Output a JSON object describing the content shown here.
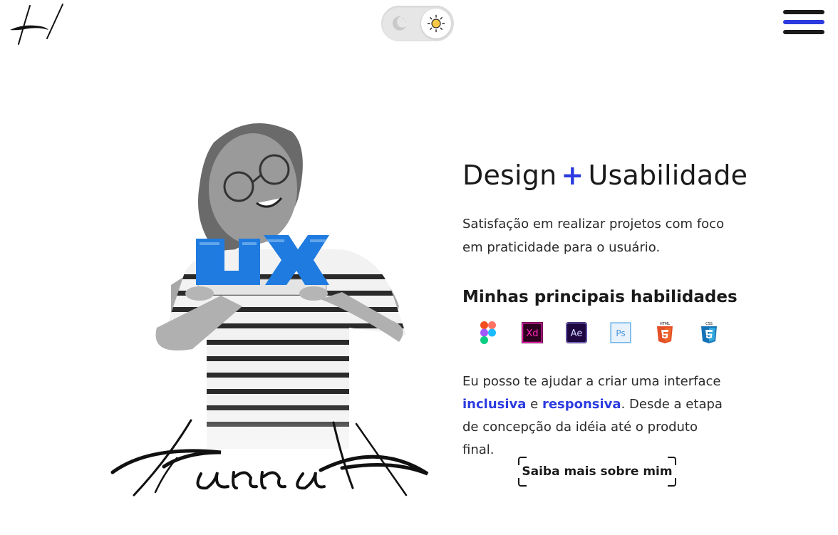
{
  "header": {
    "logo_icon": "hh-monogram-icon",
    "theme_toggle": {
      "moon_icon": "moon-icon",
      "sun_icon": "sun-icon",
      "active": "light"
    },
    "menu_icon": "hamburger-menu-icon"
  },
  "hero": {
    "signature_text": "Hanna H",
    "photo_icon": "portrait-photo-with-ux-lego-blocks",
    "block_letters": "UX"
  },
  "content": {
    "headline_left": "Design",
    "headline_plus": "+",
    "headline_right": "Usabilidade",
    "intro": "Satisfação em realizar projetos com foco em praticidade para o usuário.",
    "skills_title": "Minhas principais habilidades",
    "skills": [
      {
        "name": "Figma",
        "icon": "figma-icon"
      },
      {
        "name": "Xd",
        "icon": "adobe-xd-icon"
      },
      {
        "name": "Ae",
        "icon": "after-effects-icon"
      },
      {
        "name": "Ps",
        "icon": "photoshop-icon"
      },
      {
        "name": "HTML",
        "icon": "html5-icon"
      },
      {
        "name": "CSS",
        "icon": "css3-icon"
      }
    ],
    "desc_1": "Eu posso te ajudar a criar uma interface ",
    "desc_hl1": "inclusiva",
    "desc_2": " e ",
    "desc_hl2": "responsiva",
    "desc_3": ". Desde a etapa de concepção da idéia até o produto final.",
    "cta_label": "Saiba mais sobre mim"
  },
  "colors": {
    "accent": "#2b3be0",
    "text": "#1a1a1a",
    "background": "#ffffff"
  }
}
